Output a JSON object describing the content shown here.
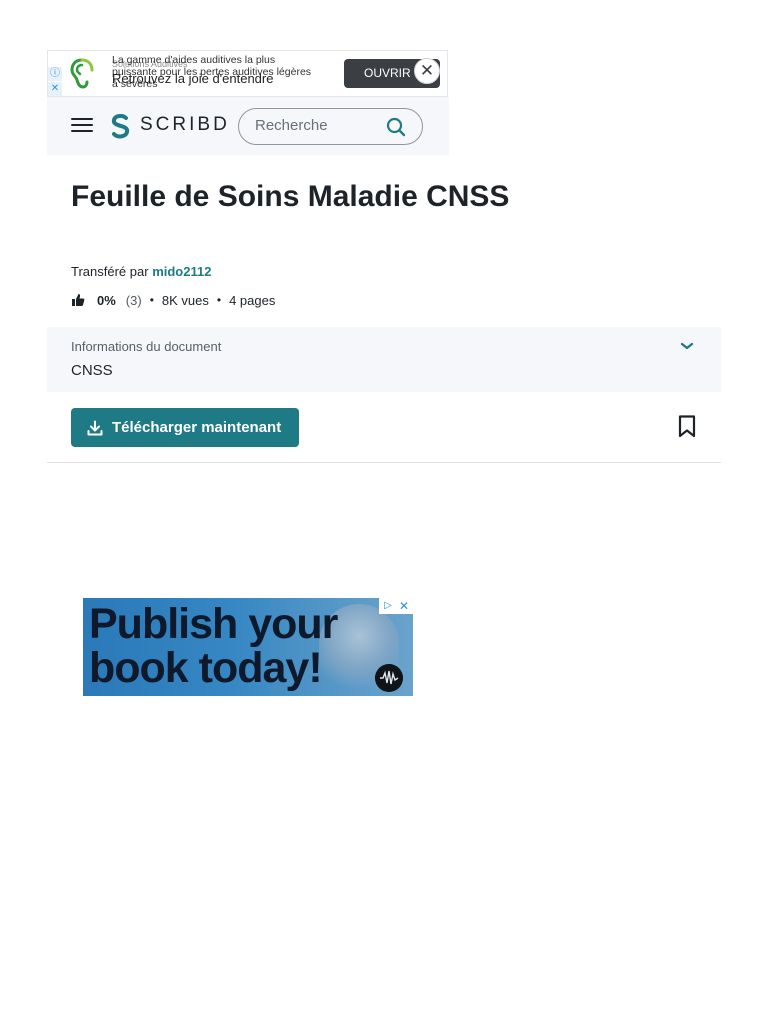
{
  "top_ad": {
    "brand": "Solutions Auditives",
    "body": "La gamme d'aides auditives la plus puissante pour les pertes auditives légères à sévères",
    "headline": "Retrouvez la joie d'entendre",
    "cta": "OUVRIR",
    "info_glyph": "ⓘ",
    "close_glyph": "✕"
  },
  "header": {
    "logo_text": "SCRIBD",
    "search_placeholder": "Recherche"
  },
  "document": {
    "title": "Feuille de Soins Maladie CNSS",
    "uploaded_by_label": "Transféré par",
    "uploader": "mido2112",
    "rating_percent": "0%",
    "rating_count": "(3)",
    "views": "8K vues",
    "pages": "4 pages",
    "separator": "•",
    "info_label": "Informations du document",
    "info_value": "CNSS",
    "download_label": "Télécharger maintenant"
  },
  "bottom_ad": {
    "text_line1": "Publish your",
    "text_line2": "book today!",
    "adchoice_glyph": "▷",
    "close_glyph": "✕"
  },
  "colors": {
    "accent": "#1e7b85",
    "header_bg": "#f5f7fa",
    "text": "#1e2329"
  },
  "icons": [
    "ear-logo-icon",
    "menu-icon",
    "scribd-logo-icon",
    "search-icon",
    "thumbs-up-icon",
    "chevron-down-icon",
    "download-icon",
    "bookmark-icon",
    "ad-info-icon",
    "ad-close-icon"
  ]
}
